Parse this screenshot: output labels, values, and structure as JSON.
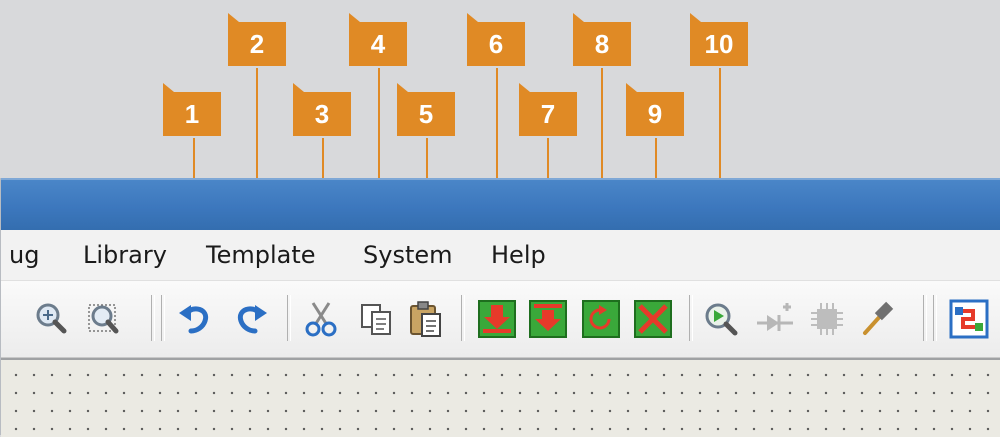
{
  "callouts": [
    "1",
    "2",
    "3",
    "4",
    "5",
    "6",
    "7",
    "8",
    "9",
    "10"
  ],
  "menu": {
    "items": [
      "ug",
      "Library",
      "Template",
      "System",
      "Help"
    ]
  },
  "toolbar": {
    "icons": [
      "zoom-in-icon",
      "zoom-area-icon",
      "undo-icon",
      "redo-icon",
      "cut-icon",
      "copy-icon",
      "paste-icon",
      "download-green-icon",
      "download-red-icon",
      "cycle-green-icon",
      "cancel-red-icon",
      "search-play-icon",
      "component-add-icon",
      "chip-icon",
      "hammer-icon",
      "netlist-icon"
    ]
  },
  "colors": {
    "callout": "#e08a25",
    "titlebar": "#3c77bd",
    "canvas": "#ebeae3"
  }
}
